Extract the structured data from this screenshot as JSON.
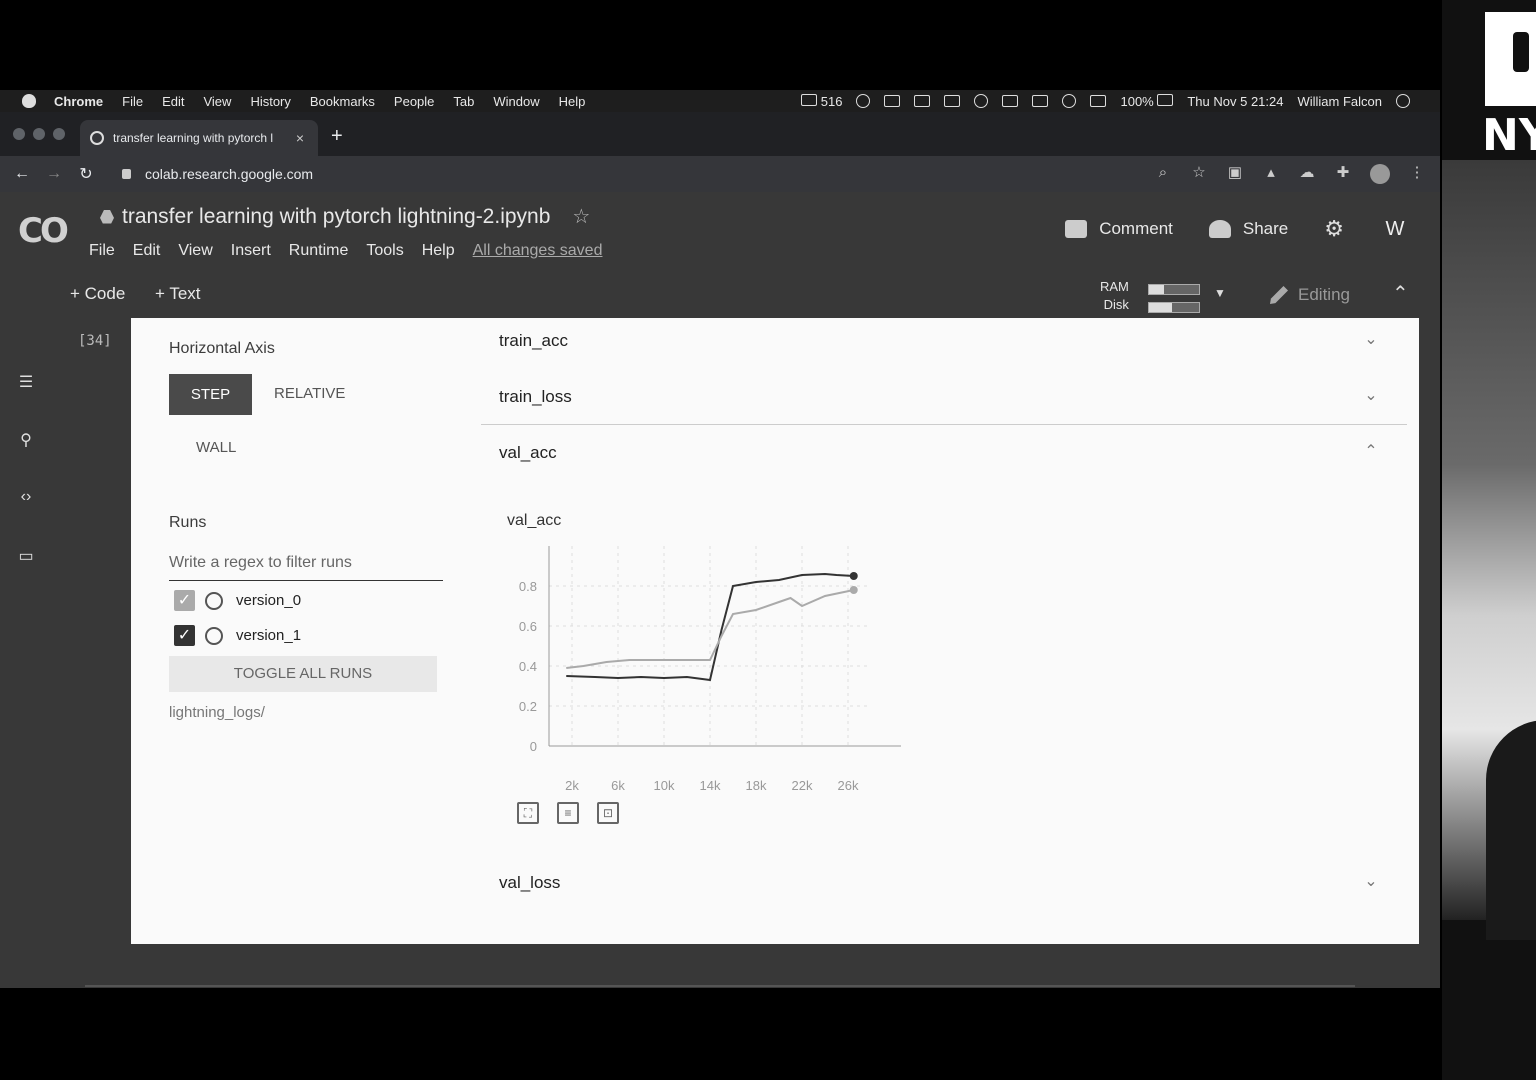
{
  "menubar": {
    "app": "Chrome",
    "items": [
      "File",
      "Edit",
      "View",
      "History",
      "Bookmarks",
      "People",
      "Tab",
      "Window",
      "Help"
    ],
    "mail_count": "516",
    "battery": "100%",
    "datetime": "Thu Nov 5  21:24",
    "user": "William Falcon"
  },
  "browser": {
    "tab_title": "transfer learning with pytorch l",
    "tab_close": "×",
    "new_tab": "+",
    "url": "colab.research.google.com"
  },
  "colab": {
    "logo": "CO",
    "notebook_title": "transfer learning with pytorch lightning-2.ipynb",
    "menu": [
      "File",
      "Edit",
      "View",
      "Insert",
      "Runtime",
      "Tools",
      "Help"
    ],
    "save_status": "All changes saved",
    "comment_label": "Comment",
    "share_label": "Share",
    "avatar_letter": "W",
    "add_code": "+ Code",
    "add_text": "+ Text",
    "ram_label": "RAM",
    "disk_label": "Disk",
    "ram_usage": 0.3,
    "disk_usage": 0.45,
    "editing_label": "Editing",
    "cell_number": "[34]"
  },
  "tensorboard": {
    "horizontal_axis_label": "Horizontal Axis",
    "axis_options": [
      "STEP",
      "RELATIVE",
      "WALL"
    ],
    "selected_axis": "STEP",
    "runs_label": "Runs",
    "regex_placeholder": "Write a regex to filter runs",
    "runs": [
      {
        "name": "version_0",
        "checked": true,
        "color": "#aaaaaa"
      },
      {
        "name": "version_1",
        "checked": true,
        "color": "#333333"
      }
    ],
    "toggle_all": "TOGGLE ALL RUNS",
    "logdir": "lightning_logs/",
    "panes": [
      {
        "title": "train_acc",
        "expanded": false
      },
      {
        "title": "train_loss",
        "expanded": false
      },
      {
        "title": "val_acc",
        "expanded": true
      },
      {
        "title": "val_loss",
        "expanded": false
      }
    ],
    "chart_title": "val_acc"
  },
  "chart_data": {
    "type": "line",
    "title": "val_acc",
    "xlabel": "",
    "ylabel": "",
    "xlim": [
      0,
      28000
    ],
    "ylim": [
      0,
      1
    ],
    "x_ticks": [
      "2k",
      "6k",
      "10k",
      "14k",
      "18k",
      "22k",
      "26k"
    ],
    "x_tick_values": [
      2000,
      6000,
      10000,
      14000,
      18000,
      22000,
      26000
    ],
    "y_ticks": [
      "0",
      "0.2",
      "0.4",
      "0.6",
      "0.8"
    ],
    "y_tick_values": [
      0,
      0.2,
      0.4,
      0.6,
      0.8
    ],
    "grid": true,
    "series": [
      {
        "color": "#333333",
        "x": [
          1500,
          4000,
          6000,
          8000,
          10000,
          12000,
          14000,
          15000,
          16000,
          18000,
          20000,
          22000,
          24000,
          25000,
          26500
        ],
        "values": [
          0.35,
          0.345,
          0.34,
          0.345,
          0.34,
          0.345,
          0.33,
          0.58,
          0.8,
          0.82,
          0.83,
          0.855,
          0.86,
          0.855,
          0.85
        ]
      },
      {
        "color": "#aaaaaa",
        "x": [
          1500,
          3000,
          5000,
          7000,
          9000,
          11000,
          13000,
          14000,
          15000,
          16000,
          18000,
          20000,
          21000,
          22000,
          24000,
          26500
        ],
        "values": [
          0.39,
          0.4,
          0.42,
          0.43,
          0.43,
          0.43,
          0.43,
          0.43,
          0.55,
          0.66,
          0.68,
          0.72,
          0.74,
          0.7,
          0.75,
          0.78
        ]
      }
    ]
  }
}
